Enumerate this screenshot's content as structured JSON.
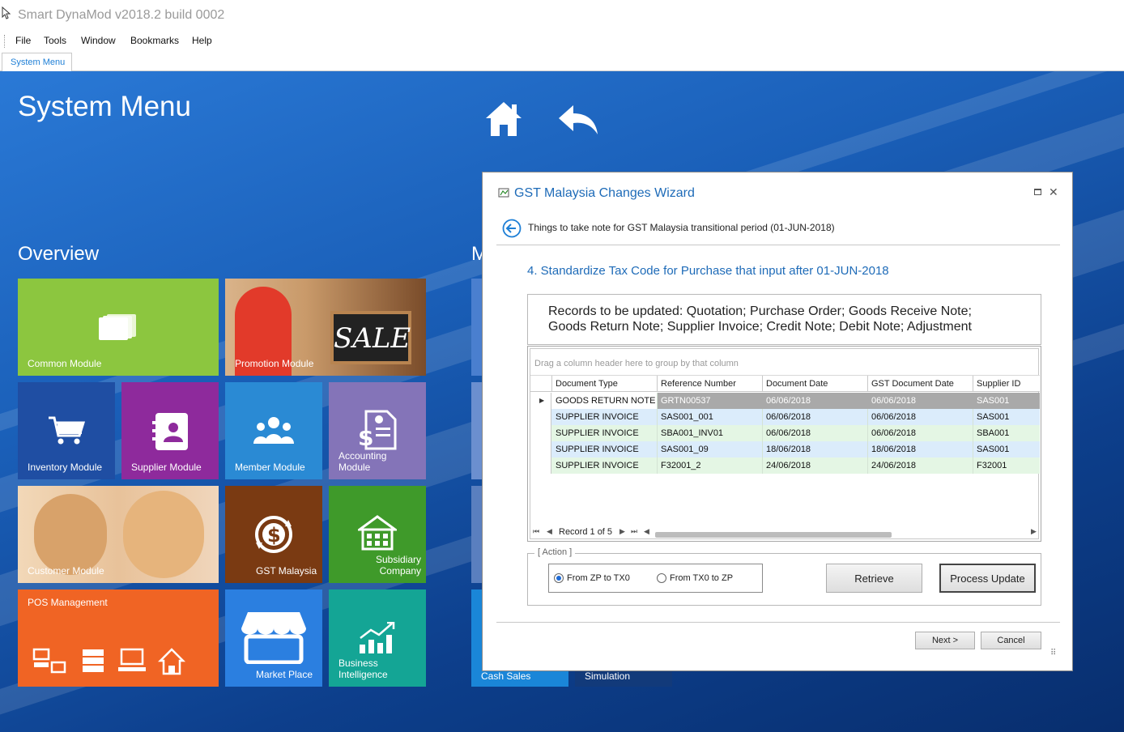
{
  "app": {
    "title": "Smart DynaMod v2018.2 build 0002",
    "menu": [
      "File",
      "Tools",
      "Window",
      "Bookmarks",
      "Help"
    ],
    "tab": "System Menu"
  },
  "desktop": {
    "title": "System Menu",
    "section_overview": "Overview",
    "section_second_partial": "M",
    "tiles": {
      "common": "Common Module",
      "promotion": "Promotion Module",
      "inventory": "Inventory Module",
      "supplier": "Supplier Module",
      "member": "Member Module",
      "accounting": "Accounting Module",
      "customer": "Customer Module",
      "gst": "GST Malaysia",
      "subsidiary": "Subsidiary Company",
      "pos": "POS Management",
      "marketplace": "Market Place",
      "bi": "Business Intelligence",
      "cashsales": "Cash Sales",
      "simulation": "Simulation"
    },
    "sale_sign": "SALE",
    "colors": {
      "common": "#8cc63f",
      "inventory": "#1f4ea3",
      "supplier": "#8e2a9c",
      "member": "#2a8ad4",
      "accounting": "#8474b8",
      "gst": "#7a3a12",
      "subsidiary": "#3f9a2a",
      "pos": "#f06424",
      "marketplace": "#2b7fe0",
      "bi": "#14a595"
    }
  },
  "dialog": {
    "title": "GST Malaysia Changes Wizard",
    "note": "Things to take note for GST Malaysia transitional period (01-JUN-2018)",
    "step": "4. Standardize Tax Code for Purchase that input after 01-JUN-2018",
    "records_line1": "Records to be updated: Quotation; Purchase Order; Goods Receive Note;",
    "records_line2": "Goods Return Note; Supplier Invoice; Credit Note; Debit Note; Adjustment",
    "group_hint": "Drag a column header here to group by that column",
    "columns": [
      "Document Type",
      "Reference Number",
      "Document Date",
      "GST Document Date",
      "Supplier ID"
    ],
    "rows": [
      [
        "GOODS RETURN NOTE",
        "GRTN00537",
        "06/06/2018",
        "06/06/2018",
        "SAS001"
      ],
      [
        "SUPPLIER INVOICE",
        "SAS001_001",
        "06/06/2018",
        "06/06/2018",
        "SAS001"
      ],
      [
        "SUPPLIER INVOICE",
        "SBA001_INV01",
        "06/06/2018",
        "06/06/2018",
        "SBA001"
      ],
      [
        "SUPPLIER INVOICE",
        "SAS001_09",
        "18/06/2018",
        "18/06/2018",
        "SAS001"
      ],
      [
        "SUPPLIER INVOICE",
        "F32001_2",
        "24/06/2018",
        "24/06/2018",
        "F32001"
      ]
    ],
    "record_nav": "Record 1 of 5",
    "action_title": "[ Action ]",
    "radio1": "From ZP to TX0",
    "radio2": "From TX0 to ZP",
    "retrieve": "Retrieve",
    "process_update": "Process Update",
    "next": "Next >",
    "cancel": "Cancel"
  }
}
